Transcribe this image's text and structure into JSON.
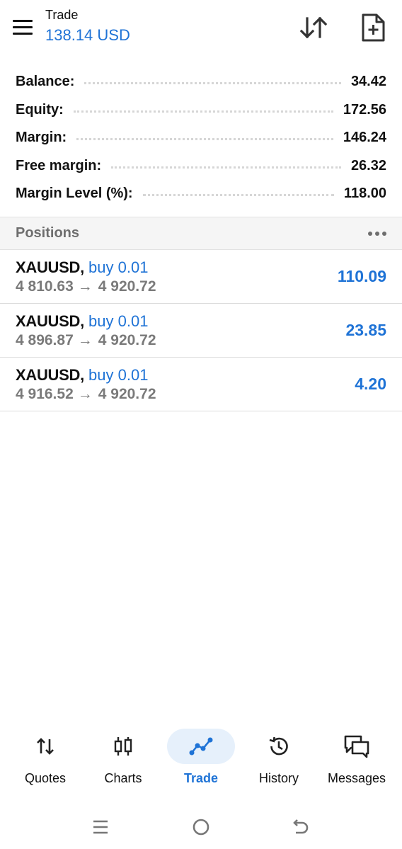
{
  "header": {
    "title": "Trade",
    "equity": "138.14 USD"
  },
  "summary": [
    {
      "label": "Balance:",
      "value": "34.42"
    },
    {
      "label": "Equity:",
      "value": "172.56"
    },
    {
      "label": "Margin:",
      "value": "146.24"
    },
    {
      "label": "Free margin:",
      "value": "26.32"
    },
    {
      "label": "Margin Level (%):",
      "value": "118.00"
    }
  ],
  "positions": {
    "title": "Positions",
    "items": [
      {
        "symbol": "XAUUSD,",
        "side": "buy 0.01",
        "open_price": "4 810.63",
        "arrow": "→",
        "current_price": "4 920.72",
        "profit": "110.09"
      },
      {
        "symbol": "XAUUSD,",
        "side": "buy 0.01",
        "open_price": "4 896.87",
        "arrow": "→",
        "current_price": "4 920.72",
        "profit": "23.85"
      },
      {
        "symbol": "XAUUSD,",
        "side": "buy 0.01",
        "open_price": "4 916.52",
        "arrow": "→",
        "current_price": "4 920.72",
        "profit": "4.20"
      }
    ]
  },
  "nav": {
    "items": [
      {
        "label": "Quotes",
        "icon": "quotes-icon"
      },
      {
        "label": "Charts",
        "icon": "candlestick-icon"
      },
      {
        "label": "Trade",
        "icon": "trade-icon"
      },
      {
        "label": "History",
        "icon": "history-icon"
      },
      {
        "label": "Messages",
        "icon": "messages-icon"
      }
    ],
    "active": "Trade"
  },
  "colors": {
    "accent": "#1f73d6",
    "secondary_text": "#7a7a7a",
    "section_bg": "#f5f5f5"
  }
}
